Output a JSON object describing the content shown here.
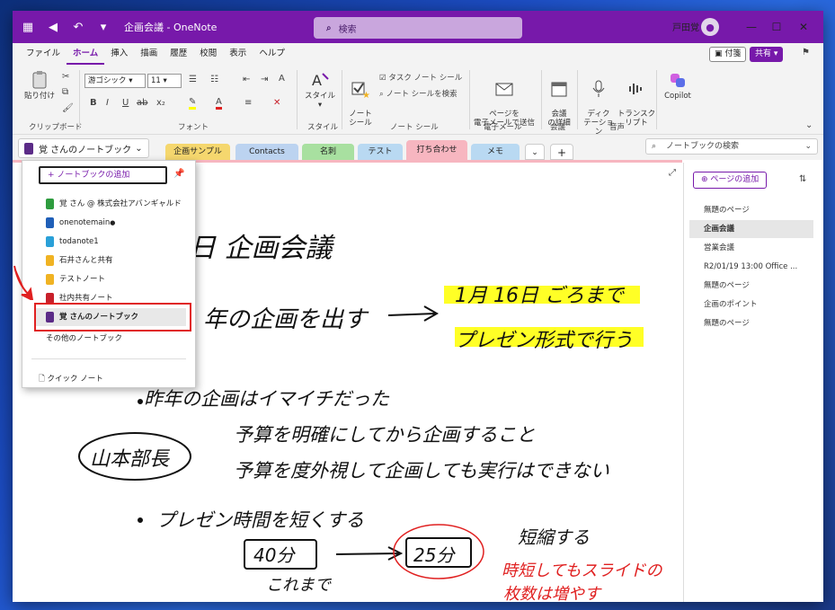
{
  "window": {
    "title": "企画会議 - OneNote",
    "search_placeholder": "検索",
    "user_name": "戸田覚"
  },
  "menu": [
    "ファイル",
    "ホーム",
    "挿入",
    "描画",
    "履歴",
    "校閲",
    "表示",
    "ヘルプ"
  ],
  "menu_active": "ホーム",
  "buttons": {
    "sticky": "付箋",
    "share": "共有"
  },
  "ribbon": {
    "paste": "貼り付け",
    "font_name": "游ゴシック",
    "font_size": "11",
    "style": "スタイル",
    "note_tag": "ノート\nシール",
    "tag_task": "タスク ノート シール",
    "tag_search": "ノート シールを検索",
    "email_page": "ページを\n電子メールで送信",
    "meeting": "会議\nの詳細",
    "dictation": "ディク\nテーション",
    "transcribe": "トランスク\nリプト",
    "copilot": "Copilot",
    "groups": [
      "クリップボード",
      "フォント",
      "スタイル",
      "ノート シール",
      "電子メール",
      "会議",
      "音声"
    ]
  },
  "notebook_button": "覚 さんのノートブック",
  "section_tabs": [
    {
      "label": "企画サンプル",
      "color": "#f5d76e"
    },
    {
      "label": "Contacts",
      "color": "#bcd3f0"
    },
    {
      "label": "名刺",
      "color": "#a8e0a0"
    },
    {
      "label": "テスト",
      "color": "#b9d9f2"
    },
    {
      "label": "打ち合わせ",
      "color": "#f7b6c0"
    },
    {
      "label": "メモ",
      "color": "#b9d9f2"
    }
  ],
  "notebook_search": "ノートブックの検索",
  "pages": {
    "add_page": "ページの追加",
    "items": [
      "無題のページ",
      "企画会議",
      "営業会議",
      "R2/01/19 13:00 Office ...",
      "無題のページ",
      "企画のポイント",
      "無題のページ"
    ],
    "active_index": 1
  },
  "dropdown": {
    "add_notebook": "ノートブックの追加",
    "notebooks": [
      {
        "name": "覚 さん @ 株式会社アバンギャルド",
        "color": "#2e9c3e"
      },
      {
        "name": "onenotemain",
        "color": "#1f5fb8"
      },
      {
        "name": "todanote1",
        "color": "#2aa0d8"
      },
      {
        "name": "石井さんと共有",
        "color": "#f0b323"
      },
      {
        "name": "テストノート",
        "color": "#f0b323"
      },
      {
        "name": "社内共有ノート",
        "color": "#c8202a"
      },
      {
        "name": "覚 さんのノートブック",
        "color": "#5b2b87"
      }
    ],
    "other": "その他のノートブック",
    "quick_notes": "クイック ノート"
  },
  "handwriting": {
    "title": "日 企画会議",
    "line1a": "年の企画を出す",
    "line1b": "1月 16日 ごろまで",
    "line1c": "プレゼン形式で行う",
    "line2": "昨年の企画はイマイチだった",
    "line3": "予算を明確にしてから企画すること",
    "line4": "予算を度外視して企画しても実行はできない",
    "boss": "山本部長",
    "line5": "プレゼン時間を短くする",
    "before": "40分",
    "after": "25分",
    "label_before": "これまで",
    "label_after": "短縮する",
    "red_note1": "時短してもスライドの",
    "red_note2": "枚数は増やす"
  },
  "colors": {
    "accent": "#7719aa",
    "highlighter": "#ffff00",
    "red_ink": "#e02020"
  }
}
